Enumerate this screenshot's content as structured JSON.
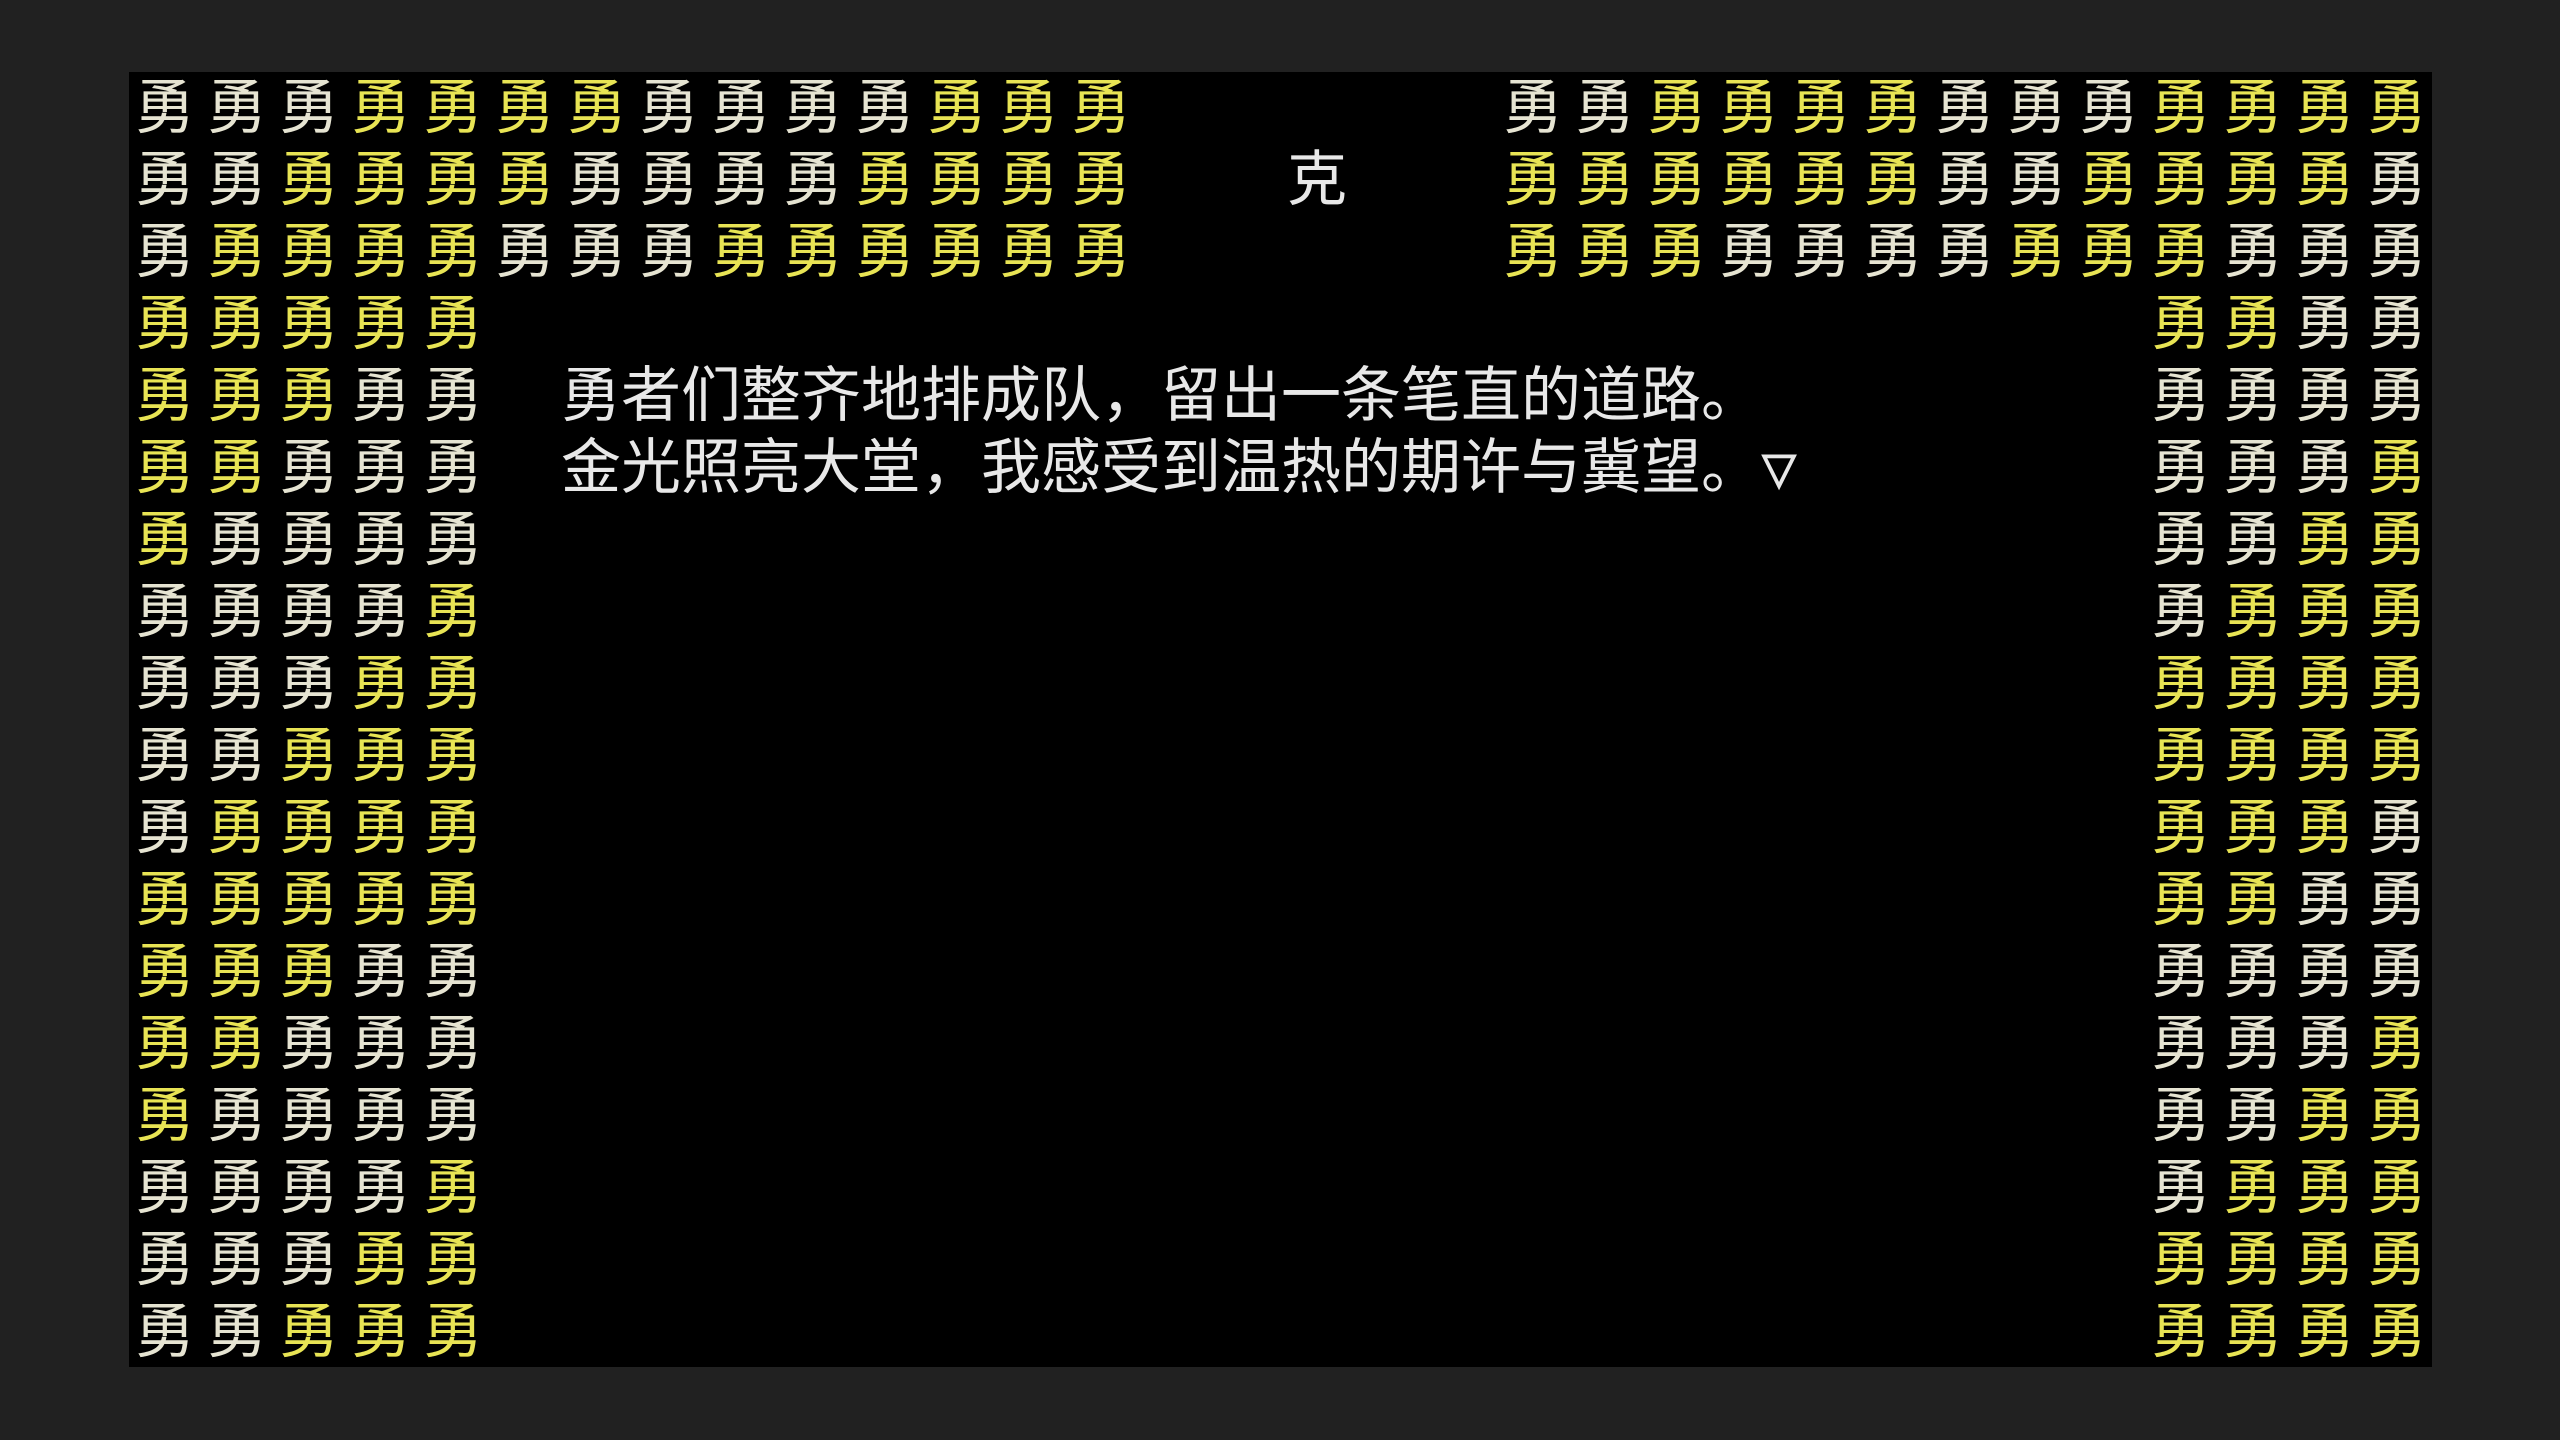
{
  "screen": {
    "crowd_glyph": "勇",
    "colors": {
      "background": "#000000",
      "frame": "#212121",
      "text": "#e8e8e8",
      "hero_yellow": "#e8e454",
      "hero_white": "#e6e4d2"
    },
    "crowd_pattern": [
      "WWWYYYYWWWWYYY.....WWYYYYWWWYYYYW",
      "WWYYYYWWWWYYYY.....YYYYYYWWYYYYWW",
      "WYYYYWWWYYYYYY.....YYYWWWWYYYWWWW",
      "YYYYY.......................YYWWW",
      "YYYWW.......................WWWWY",
      "YYWWW.......................WWWYY",
      "YWWWW.......................WWYYY",
      "WWWWY.......................WYYYY",
      "WWWYY.......................YYYYW",
      "WWYYY.......................YYYYW",
      "WYYYY.......................YYYWW",
      "YYYYY.......................YYWWW",
      "YYYWW.......................WWWWY",
      "YYWWW.......................WWWYY",
      "YWWWW.......................WWYYY",
      "WWWWY.......................WYYYY",
      "WWWYY.......................YYYYW",
      "WWYYY.......................YYYYW"
    ]
  },
  "npc": {
    "name_glyph": "克"
  },
  "dialog": {
    "lines": [
      "勇者们整齐地排成队，留出一条笔直的道路。",
      "金光照亮大堂，我感受到温热的期许与冀望。▽"
    ]
  }
}
